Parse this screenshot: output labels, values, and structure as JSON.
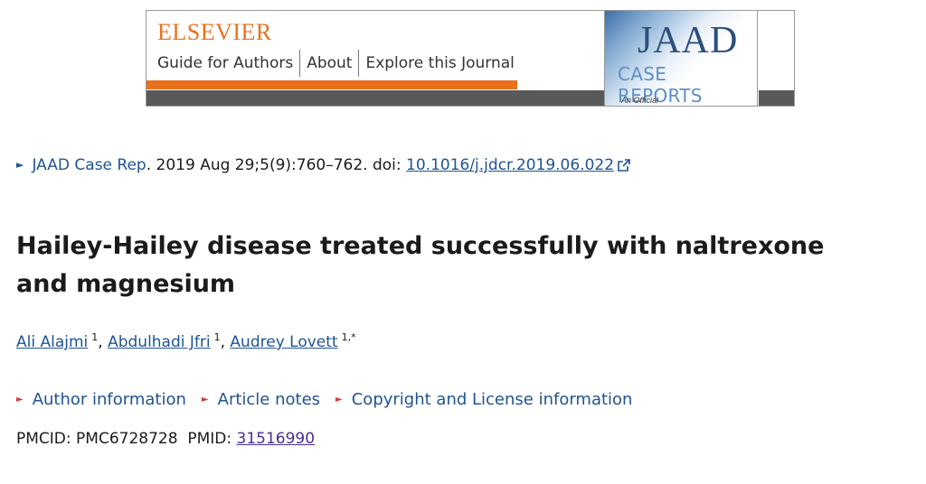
{
  "banner": {
    "publisher": "ELSEVIER",
    "nav": [
      "Guide for Authors",
      "About",
      "Explore this Journal"
    ],
    "journal_title": "JAAD",
    "journal_subtitle": "CASE REPORTS",
    "journal_tagline": "An Official",
    "accent_color": "#e9711c"
  },
  "citation": {
    "journal": "JAAD Case Rep",
    "after_journal": ". 2019 Aug 29;5(9):760–762. doi: ",
    "doi": "10.1016/j.jdcr.2019.06.022",
    "external_icon": "external-link-icon"
  },
  "article": {
    "title": "Hailey-Hailey disease treated successfully with naltrexone and magnesium"
  },
  "authors": [
    {
      "name": "Ali Alajmi",
      "sup": "1",
      "sep": ", "
    },
    {
      "name": "Abdulhadi Jfri",
      "sup": "1",
      "sep": ", "
    },
    {
      "name": "Audrey Lovett",
      "sup": "1,*",
      "sep": ""
    }
  ],
  "expanders": [
    "Author information",
    "Article notes",
    "Copyright and License information"
  ],
  "ids": {
    "pmcid_label": "PMCID: ",
    "pmcid": "PMC6728728",
    "pmid_label": "PMID: ",
    "pmid": "31516990"
  }
}
